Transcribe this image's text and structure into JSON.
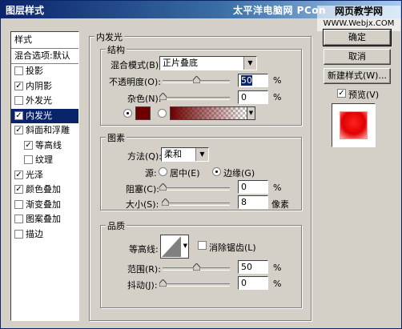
{
  "title": "图层样式",
  "watermark": {
    "text": "太平洋电脑网 PCon",
    "badge_line1": "网页教学网",
    "badge_line2": "WWW.Webjx.COM"
  },
  "left_panel": {
    "header": "样式",
    "blend_options": "混合选项:默认",
    "items": [
      {
        "label": "投影",
        "checked": false
      },
      {
        "label": "内阴影",
        "checked": true
      },
      {
        "label": "外发光",
        "checked": false
      },
      {
        "label": "内发光",
        "checked": true,
        "selected": true
      },
      {
        "label": "斜面和浮雕",
        "checked": true
      },
      {
        "label": "等高线",
        "checked": true,
        "indent": true
      },
      {
        "label": "纹理",
        "checked": false,
        "indent": true
      },
      {
        "label": "光泽",
        "checked": true
      },
      {
        "label": "颜色叠加",
        "checked": true
      },
      {
        "label": "渐变叠加",
        "checked": false
      },
      {
        "label": "图案叠加",
        "checked": false
      },
      {
        "label": "描边",
        "checked": false
      }
    ]
  },
  "section_title": "内发光",
  "structure": {
    "label": "结构",
    "blend_mode_label": "混合模式(B):",
    "blend_mode_value": "正片叠底",
    "opacity_label": "不透明度(O):",
    "opacity_value": "50",
    "opacity_unit": "%",
    "opacity_level": 0.5,
    "noise_label": "杂色(N):",
    "noise_value": "0",
    "noise_unit": "%",
    "noise_level": 0,
    "color": "#6b0000",
    "gradient_from": "#6b0000"
  },
  "elements": {
    "label": "图素",
    "method_label": "方法(Q):",
    "method_value": "柔和",
    "source_label": "源:",
    "source_center": "居中(E)",
    "source_edge": "边缘(G)",
    "choke_label": "阻塞(C):",
    "choke_value": "0",
    "choke_unit": "%",
    "choke_level": 0,
    "size_label": "大小(S):",
    "size_value": "8",
    "size_unit": "像素",
    "size_level": 0.04
  },
  "quality": {
    "label": "品质",
    "contour_label": "等高线:",
    "antialias_label": "消除锯齿(L)",
    "range_label": "范围(R):",
    "range_value": "50",
    "range_unit": "%",
    "range_level": 0.5,
    "jitter_label": "抖动(J):",
    "jitter_value": "0",
    "jitter_unit": "%",
    "jitter_level": 0
  },
  "buttons": {
    "ok": "确定",
    "cancel": "取消",
    "new_style": "新建样式(W)...",
    "preview": "预览(V)"
  }
}
